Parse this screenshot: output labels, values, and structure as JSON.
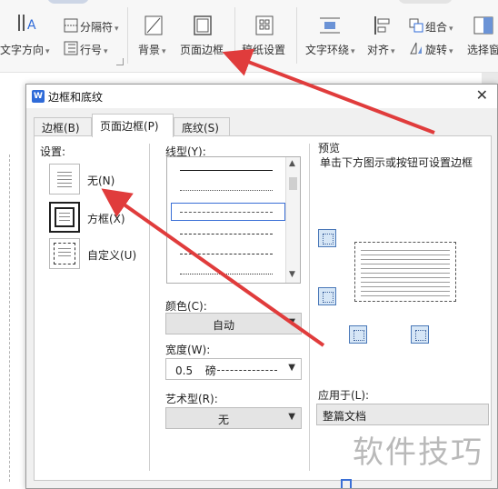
{
  "ribbon": {
    "text_direction": "文字方向",
    "columns": "分隔符",
    "line_number": "行号",
    "background": "背景",
    "page_border": "页面边框",
    "grid_paper": "稿纸设置",
    "text_wrap": "文字环绕",
    "align": "对齐",
    "group": "组合",
    "rotate": "旋转",
    "select_pane": "选择窗"
  },
  "dialog": {
    "title": "边框和底纹",
    "tabs": [
      "边框(B)",
      "页面边框(P)",
      "底纹(S)"
    ],
    "active_tab": "页面边框(P)",
    "settings_label": "设置:",
    "settings": [
      "无(N)",
      "方框(X)",
      "自定义(U)"
    ],
    "style_label": "线型(Y):",
    "color_label": "颜色(C):",
    "color_value": "自动",
    "width_label": "宽度(W):",
    "width_value": "0.5",
    "width_unit": "磅",
    "art_label": "艺术型(R):",
    "art_value": "无",
    "preview_label": "预览",
    "preview_hint": "单击下方图示或按钮可设置边框",
    "apply_label": "应用于(L):",
    "apply_value": "整篇文档"
  },
  "watermark": "软件技巧",
  "colors": {
    "arrow": "#e03c3c",
    "accent": "#3a6fd6"
  }
}
